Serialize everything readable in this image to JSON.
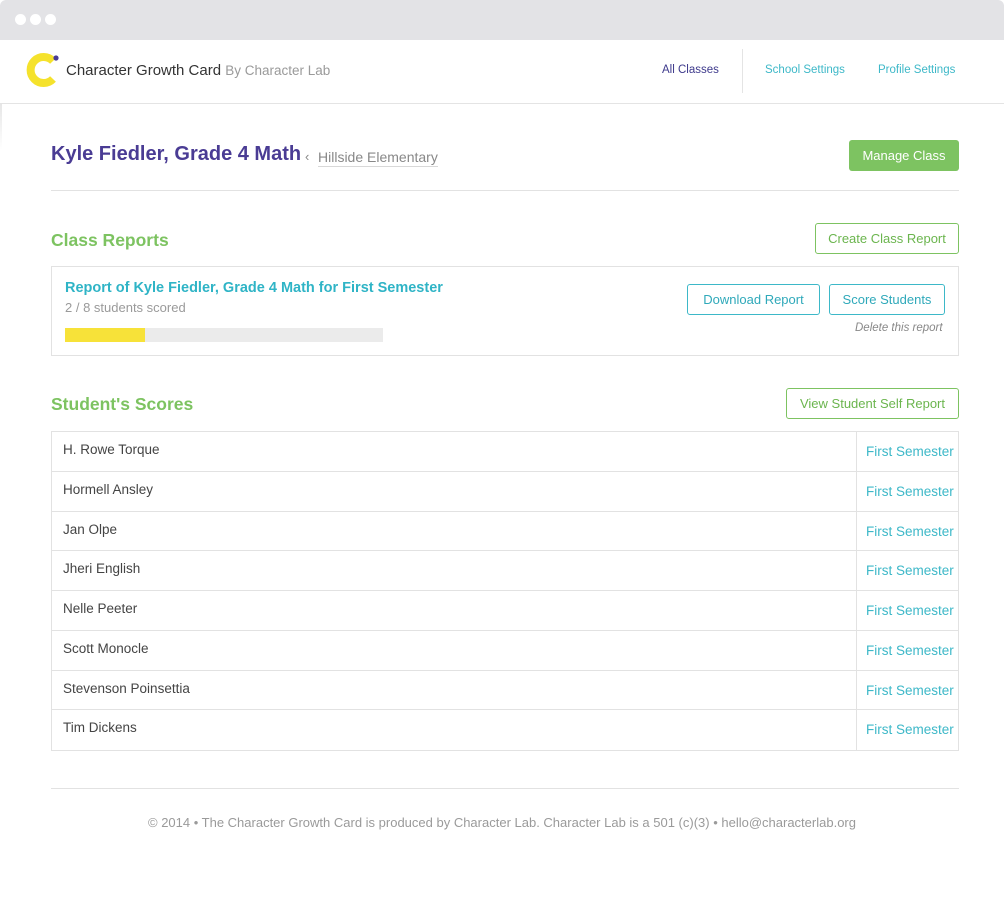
{
  "header": {
    "brand_name": "Character Growth Card",
    "brand_by": "By Character Lab",
    "nav": {
      "all_classes": "All Classes",
      "school_settings": "School Settings",
      "profile_settings": "Profile Settings"
    }
  },
  "page": {
    "title": "Kyle Fiedler, Grade 4 Math",
    "breadcrumb_separator": "‹",
    "breadcrumb_school": "Hillside Elementary",
    "manage_class_label": "Manage Class"
  },
  "class_reports": {
    "heading": "Class Reports",
    "create_button": "Create Class Report",
    "report": {
      "title": "Report of Kyle Fiedler, Grade 4 Math for First Semester",
      "status": "2 / 8 students scored",
      "progress_fraction": 0.25,
      "download_button": "Download Report",
      "score_button": "Score Students",
      "delete_link": "Delete this report"
    }
  },
  "student_scores": {
    "heading": "Student's Scores",
    "self_report_button": "View Student Self Report",
    "rows": [
      {
        "name": "H. Rowe Torque",
        "semester": "First Semester"
      },
      {
        "name": "Hormell Ansley",
        "semester": "First Semester"
      },
      {
        "name": "Jan Olpe",
        "semester": "First Semester"
      },
      {
        "name": "Jheri English",
        "semester": "First Semester"
      },
      {
        "name": "Nelle Peeter",
        "semester": "First Semester"
      },
      {
        "name": "Scott Monocle",
        "semester": "First Semester"
      },
      {
        "name": "Stevenson Poinsettia",
        "semester": "First Semester"
      },
      {
        "name": "Tim Dickens",
        "semester": "First Semester"
      }
    ]
  },
  "footer": {
    "text": "© 2014 • The Character Growth Card is produced by Character Lab. Character Lab is a 501 (c)(3) • hello@characterlab.org"
  },
  "colors": {
    "brand_purple": "#4a3c94",
    "green": "#7dc361",
    "teal": "#3db8c8",
    "progress_yellow": "#f7e239",
    "logo_yellow": "#f5e22c"
  },
  "icons": {
    "logo": "character-lab-c-logo"
  }
}
